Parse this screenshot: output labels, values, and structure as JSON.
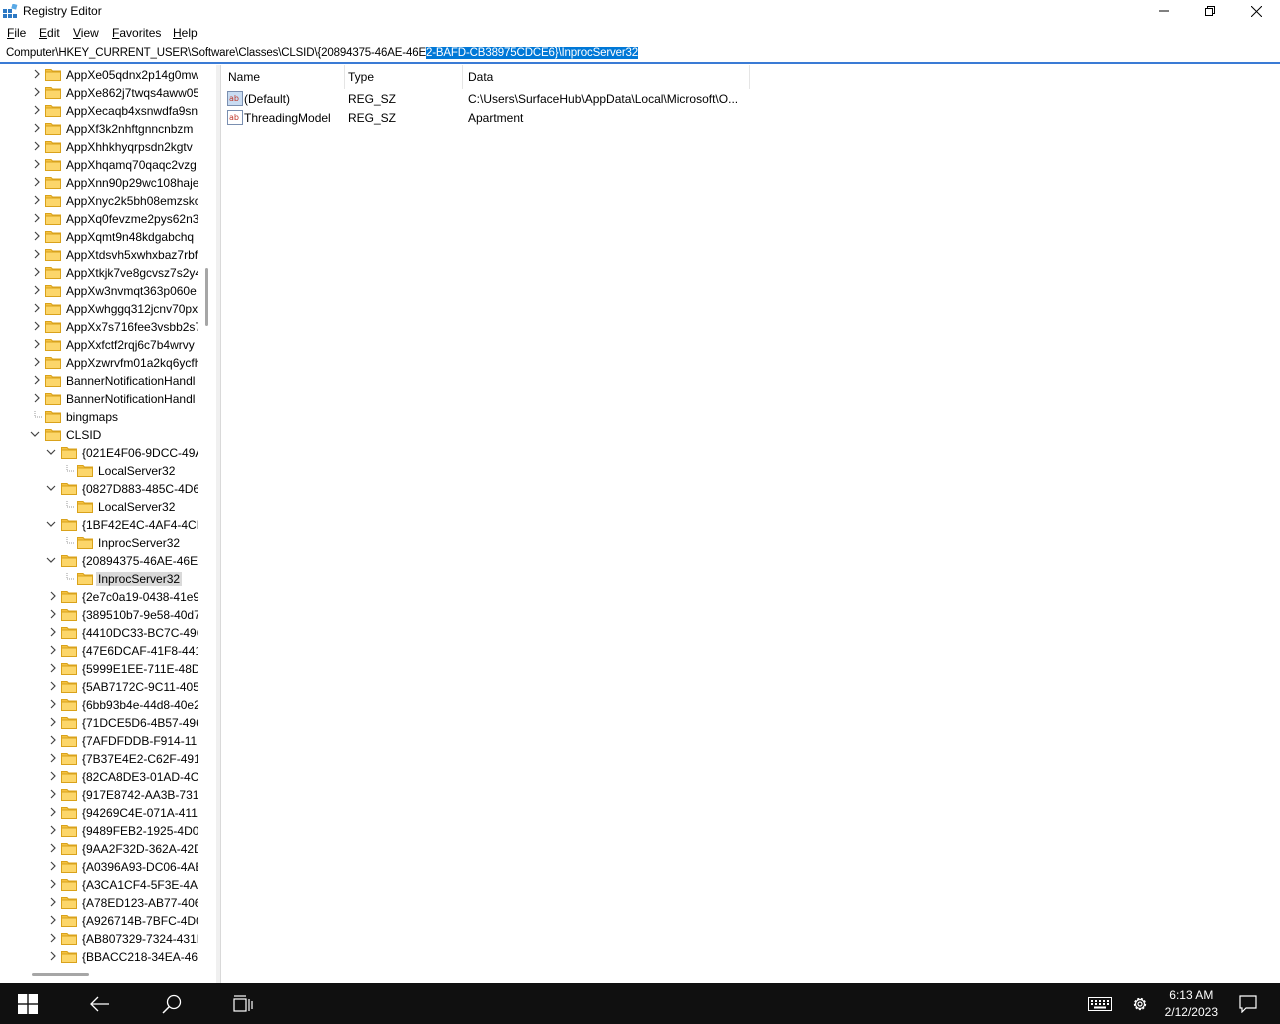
{
  "window": {
    "title": "Registry Editor",
    "controls": {
      "minimize": "—",
      "maximize": "❐",
      "close": "✕"
    }
  },
  "menu": [
    {
      "label": "File",
      "accel": "F",
      "rest": "ile"
    },
    {
      "label": "Edit",
      "accel": "E",
      "rest": "dit"
    },
    {
      "label": "View",
      "accel": "V",
      "rest": "iew"
    },
    {
      "label": "Favorites",
      "accel": "F",
      "rest": "avorites"
    },
    {
      "label": "Help",
      "accel": "H",
      "rest": "elp"
    }
  ],
  "address": {
    "prefix": "Computer\\HKEY_CURRENT_USER\\Software\\Classes\\CLSID\\{20894375-46AE-46E",
    "selected": "2-BAFD-CB38975CDCE6}\\InprocServer32"
  },
  "tree": [
    {
      "label": "AppXe05qdnx2p14g0mw",
      "level": 1,
      "state": "collapsed"
    },
    {
      "label": "AppXe862j7twqs4aww05",
      "level": 1,
      "state": "collapsed"
    },
    {
      "label": "AppXecaqb4xsnwdfa9sn",
      "level": 1,
      "state": "collapsed"
    },
    {
      "label": "AppXf3k2nhftgnncnbzm",
      "level": 1,
      "state": "collapsed"
    },
    {
      "label": "AppXhhkhyqrpsdn2kgtv",
      "level": 1,
      "state": "collapsed"
    },
    {
      "label": "AppXhqamq70qaqc2vzg",
      "level": 1,
      "state": "collapsed"
    },
    {
      "label": "AppXnn90p29wc108haje",
      "level": 1,
      "state": "collapsed"
    },
    {
      "label": "AppXnyc2k5bh08emzskc",
      "level": 1,
      "state": "collapsed"
    },
    {
      "label": "AppXq0fevzme2pys62n3",
      "level": 1,
      "state": "collapsed"
    },
    {
      "label": "AppXqmt9n48kdgabchq",
      "level": 1,
      "state": "collapsed"
    },
    {
      "label": "AppXtdsvh5xwhxbaz7rbf",
      "level": 1,
      "state": "collapsed"
    },
    {
      "label": "AppXtkjk7ve8gcvsz7s2y4",
      "level": 1,
      "state": "collapsed"
    },
    {
      "label": "AppXw3nvmqt363p060e",
      "level": 1,
      "state": "collapsed"
    },
    {
      "label": "AppXwhggq312jcnv70px",
      "level": 1,
      "state": "collapsed"
    },
    {
      "label": "AppXx7s716fee3vsbb2s7",
      "level": 1,
      "state": "collapsed"
    },
    {
      "label": "AppXxfctf2rqj6c7b4wrvy",
      "level": 1,
      "state": "collapsed"
    },
    {
      "label": "AppXzwrvfm01a2kq6ycfh",
      "level": 1,
      "state": "collapsed"
    },
    {
      "label": "BannerNotificationHandl",
      "level": 1,
      "state": "collapsed"
    },
    {
      "label": "BannerNotificationHandl",
      "level": 1,
      "state": "collapsed"
    },
    {
      "label": "bingmaps",
      "level": 1,
      "state": "leaf"
    },
    {
      "label": "CLSID",
      "level": 1,
      "state": "expanded"
    },
    {
      "label": "{021E4F06-9DCC-49AI",
      "level": 2,
      "state": "expanded"
    },
    {
      "label": "LocalServer32",
      "level": 3,
      "state": "leaf"
    },
    {
      "label": "{0827D883-485C-4D62",
      "level": 2,
      "state": "expanded"
    },
    {
      "label": "LocalServer32",
      "level": 3,
      "state": "leaf"
    },
    {
      "label": "{1BF42E4C-4AF4-4CFI",
      "level": 2,
      "state": "expanded"
    },
    {
      "label": "InprocServer32",
      "level": 3,
      "state": "leaf"
    },
    {
      "label": "{20894375-46AE-46E2-",
      "level": 2,
      "state": "expanded"
    },
    {
      "label": "InprocServer32",
      "level": 3,
      "state": "leaf",
      "selected": true
    },
    {
      "label": "{2e7c0a19-0438-41e9-",
      "level": 2,
      "state": "collapsed"
    },
    {
      "label": "{389510b7-9e58-40d7-",
      "level": 2,
      "state": "collapsed"
    },
    {
      "label": "{4410DC33-BC7C-496I",
      "level": 2,
      "state": "collapsed"
    },
    {
      "label": "{47E6DCAF-41F8-441C",
      "level": 2,
      "state": "collapsed"
    },
    {
      "label": "{5999E1EE-711E-48D2-",
      "level": 2,
      "state": "collapsed"
    },
    {
      "label": "{5AB7172C-9C11-405C",
      "level": 2,
      "state": "collapsed"
    },
    {
      "label": "{6bb93b4e-44d8-40e2",
      "level": 2,
      "state": "collapsed"
    },
    {
      "label": "{71DCE5D6-4B57-496E",
      "level": 2,
      "state": "collapsed"
    },
    {
      "label": "{7AFDFDDB-F914-11E",
      "level": 2,
      "state": "collapsed"
    },
    {
      "label": "{7B37E4E2-C62F-4914",
      "level": 2,
      "state": "collapsed"
    },
    {
      "label": "{82CA8DE3-01AD-4CE",
      "level": 2,
      "state": "collapsed"
    },
    {
      "label": "{917E8742-AA3B-7318",
      "level": 2,
      "state": "collapsed"
    },
    {
      "label": "{94269C4E-071A-4116",
      "level": 2,
      "state": "collapsed"
    },
    {
      "label": "{9489FEB2-1925-4D01-",
      "level": 2,
      "state": "collapsed"
    },
    {
      "label": "{9AA2F32D-362A-42D",
      "level": 2,
      "state": "collapsed"
    },
    {
      "label": "{A0396A93-DC06-4AE",
      "level": 2,
      "state": "collapsed"
    },
    {
      "label": "{A3CA1CF4-5F3E-4AC",
      "level": 2,
      "state": "collapsed"
    },
    {
      "label": "{A78ED123-AB77-406E",
      "level": 2,
      "state": "collapsed"
    },
    {
      "label": "{A926714B-7BFC-4D08",
      "level": 2,
      "state": "collapsed"
    },
    {
      "label": "{AB807329-7324-431B",
      "level": 2,
      "state": "collapsed"
    },
    {
      "label": "{BBACC218-34EA-466",
      "level": 2,
      "state": "collapsed"
    }
  ],
  "columns": {
    "name": "Name",
    "type": "Type",
    "data": "Data"
  },
  "values": [
    {
      "name": "(Default)",
      "type": "REG_SZ",
      "data": "C:\\Users\\SurfaceHub\\AppData\\Local\\Microsoft\\O...",
      "icon": "string-value-icon"
    },
    {
      "name": "ThreadingModel",
      "type": "REG_SZ",
      "data": "Apartment",
      "icon": "string-value-icon"
    }
  ],
  "taskbar": {
    "time": "6:13 AM",
    "date": "2/12/2023"
  },
  "colors": {
    "selection": "#0078d7",
    "folder": "#f5c242",
    "taskbar": "#101010"
  }
}
